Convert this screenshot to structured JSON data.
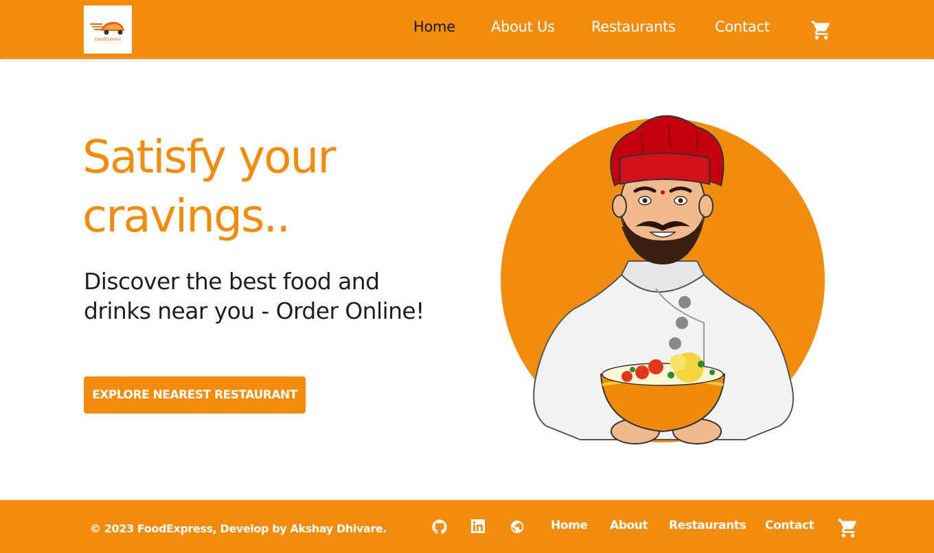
{
  "brand": {
    "logo_text": "FoodExpress",
    "primary_color": "#f28c0f",
    "logo_accent": "#e0661b"
  },
  "nav": {
    "items": [
      {
        "label": "Home",
        "active": true
      },
      {
        "label": "About Us",
        "active": false
      },
      {
        "label": "Restaurants",
        "active": false
      },
      {
        "label": "Contact",
        "active": false
      }
    ],
    "cart_icon": "cart-icon"
  },
  "hero": {
    "title_line1": "Satisfy your",
    "title_line2": "cravings..",
    "subtitle": "Discover the best food and drinks near you - Order Online!",
    "cta_label": "EXPLORE NEAREST RESTAURANT",
    "illustration": "chef-holding-bowl"
  },
  "footer": {
    "copyright": "© 2023 FoodExpress, Develop by Akshay Dhivare.",
    "social_icons": [
      "github-icon",
      "linkedin-icon",
      "globe-icon"
    ],
    "links": [
      "Home",
      "About",
      "Restaurants",
      "Contact"
    ],
    "cart_icon": "cart-icon"
  }
}
